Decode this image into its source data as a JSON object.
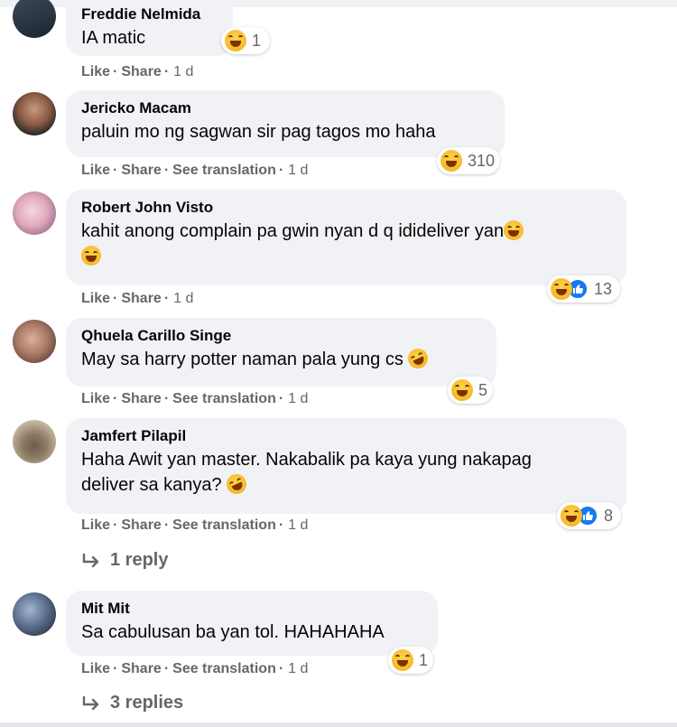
{
  "actions": {
    "like": "Like",
    "share": "Share",
    "see_translation": "See translation",
    "separator": "·"
  },
  "comments": [
    {
      "author": "Freddie Nelmida",
      "text": "IA matic",
      "time": "1 d",
      "reaction_count": "1",
      "reactions": [
        "haha"
      ]
    },
    {
      "author": "Jericko Macam",
      "text": "paluin mo ng sagwan sir pag tagos mo haha",
      "time": "1 d",
      "reaction_count": "310",
      "reactions": [
        "haha"
      ],
      "see_translation": true
    },
    {
      "author": "Robert John Visto",
      "text": "kahit anong complain pa gwin nyan d q idideliver yan",
      "time": "1 d",
      "reaction_count": "13",
      "reactions": [
        "haha",
        "like"
      ]
    },
    {
      "author": "Qhuela Carillo Singe",
      "text": "May sa harry potter naman pala yung cs",
      "time": "1 d",
      "reaction_count": "5",
      "reactions": [
        "haha"
      ],
      "see_translation": true
    },
    {
      "author": "Jamfert Pilapil",
      "text_line1": "Haha Awit yan master. Nakabalik pa kaya yung nakapag",
      "text_line2": "deliver sa kanya?",
      "time": "1 d",
      "reaction_count": "8",
      "reactions": [
        "haha",
        "like"
      ],
      "see_translation": true,
      "replies_label": "1 reply"
    },
    {
      "author": "Mit Mit",
      "text": "Sa cabulusan ba yan tol. HAHAHAHA",
      "time": "1 d",
      "reaction_count": "1",
      "reactions": [
        "haha"
      ],
      "see_translation": true,
      "replies_label": "3 replies"
    }
  ],
  "colors": {
    "bubble": "#f0f2f5",
    "muted_text": "#65676b",
    "like_blue": "#1877f2",
    "haha_yellow": "#f7b928"
  }
}
